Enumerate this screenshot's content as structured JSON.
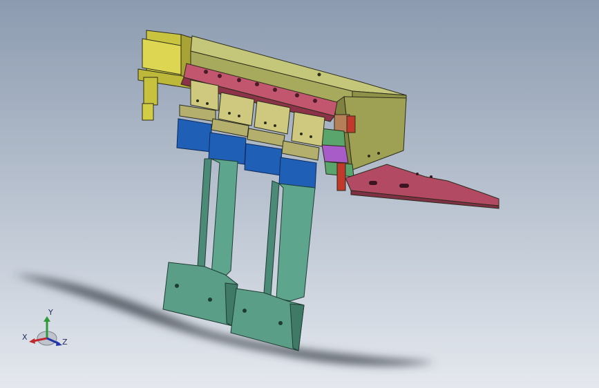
{
  "viewport": {
    "background_top": "#8c9bb0",
    "background_bottom": "#e4e8ee"
  },
  "triad": {
    "x_label": "X",
    "y_label": "Y",
    "z_label": "Z",
    "x_color": "#c0282d",
    "y_color": "#2e9a3a",
    "z_color": "#2233aa"
  },
  "part_colors": {
    "top_plate": "#b9bd6a",
    "cylinder": "#d6d14e",
    "clamp_bar": "#b34a63",
    "blocks": "#c8c27a",
    "blue_caps": "#1f5fb5",
    "legs": "#4f9883",
    "bottom_arm": "#b34a63",
    "small_parts_green": "#5aa56c",
    "small_parts_purple": "#a85cc7",
    "small_parts_red": "#c0392b"
  }
}
